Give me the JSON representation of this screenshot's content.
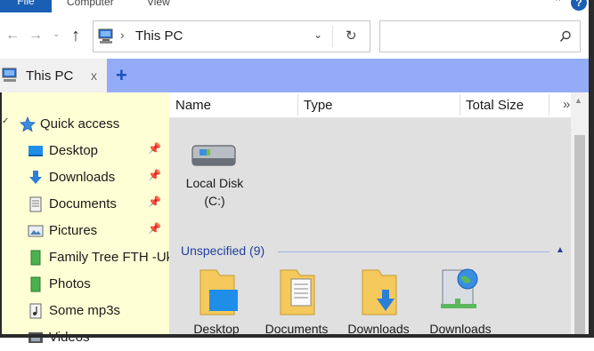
{
  "ribbon": {
    "file": "File",
    "computer": "Computer",
    "view": "View",
    "help": "?"
  },
  "address": {
    "location_icon": "this-pc-icon",
    "separator": "›",
    "path": "This PC",
    "search_placeholder": ""
  },
  "tab": {
    "title": "This PC",
    "close": "x",
    "new": "+"
  },
  "sidebar": {
    "items": [
      {
        "label": "Quick access",
        "icon": "star-icon"
      },
      {
        "label": "Desktop",
        "icon": "desktop-folder-icon",
        "pinned": true
      },
      {
        "label": "Downloads",
        "icon": "downloads-arrow-icon",
        "pinned": true
      },
      {
        "label": "Documents",
        "icon": "documents-icon",
        "pinned": true
      },
      {
        "label": "Pictures",
        "icon": "pictures-icon",
        "pinned": true
      },
      {
        "label": "Family Tree FTH -Uk",
        "icon": "green-folder-icon"
      },
      {
        "label": "Photos",
        "icon": "green-folder-icon"
      },
      {
        "label": "Some mp3s",
        "icon": "music-icon"
      },
      {
        "label": "Videos",
        "icon": "videos-icon"
      }
    ]
  },
  "columns": {
    "name": "Name",
    "type": "Type",
    "size": "Total Size",
    "more": "»"
  },
  "drive": {
    "name": "Local Disk",
    "letter": "(C:)"
  },
  "group": {
    "title": "Unspecified (9)"
  },
  "folders": [
    "Desktop",
    "Documents",
    "Downloads",
    "Downloads"
  ],
  "colors": {
    "tabstrip": "#94acf7",
    "sidebar": "#ffffd5",
    "content": "#e0e0e0",
    "accent": "#1a5fb4"
  }
}
